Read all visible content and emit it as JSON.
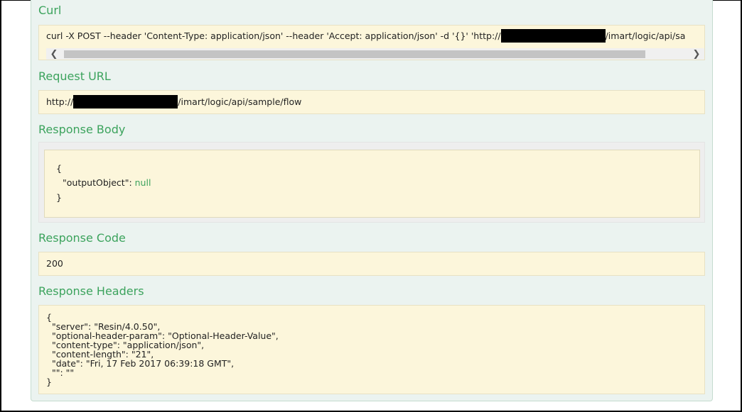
{
  "curl": {
    "heading": "Curl",
    "command_prefix": "curl -X POST --header 'Content-Type: application/json' --header 'Accept: application/json' -d '{}' 'http://",
    "command_suffix": "/imart/logic/api/sa"
  },
  "request_url": {
    "heading": "Request URL",
    "prefix": "http://",
    "suffix": "/imart/logic/api/sample/flow"
  },
  "response_body": {
    "heading": "Response Body",
    "open_brace": "{",
    "key": "\"outputObject\": ",
    "value": "null",
    "close_brace": "}"
  },
  "response_code": {
    "heading": "Response Code",
    "value": "200"
  },
  "response_headers": {
    "heading": "Response Headers",
    "lines": [
      "{",
      "  \"server\": \"Resin/4.0.50\",",
      "  \"optional-header-param\": \"Optional-Header-Value\",",
      "  \"content-type\": \"application/json\",",
      "  \"content-length\": \"21\",",
      "  \"date\": \"Fri, 17 Feb 2017 06:39:18 GMT\",",
      "  \"\": \"\"",
      "}"
    ]
  },
  "icons": {
    "scroll_left": "chevron-left-icon",
    "scroll_right": "chevron-right-icon"
  },
  "colors": {
    "heading": "#3ca35d",
    "panel_bg": "#ebf3f0",
    "box_bg": "#fcf6db",
    "redaction": "#000000"
  }
}
